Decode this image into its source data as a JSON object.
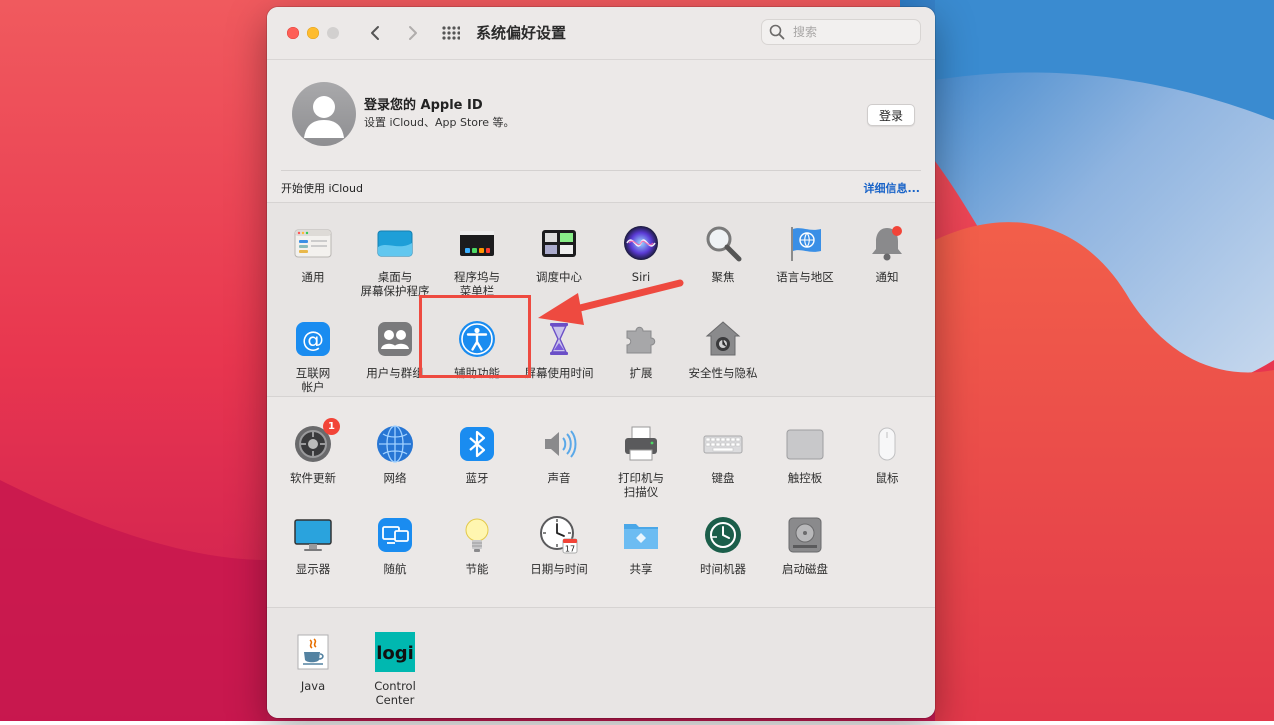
{
  "window": {
    "title": "系统偏好设置",
    "search_placeholder": "搜索"
  },
  "account": {
    "title": "登录您的 Apple ID",
    "subtitle": "设置 iCloud、App Store 等。",
    "signin_label": "登录"
  },
  "icloud": {
    "label": "开始使用 iCloud",
    "link": "详细信息..."
  },
  "panes_row1": [
    {
      "label": "通用",
      "icon": "general-icon"
    },
    {
      "label": "桌面与\n屏幕保护程序",
      "icon": "desktop-screensaver-icon"
    },
    {
      "label": "程序坞与\n菜单栏",
      "icon": "dock-menubar-icon"
    },
    {
      "label": "调度中心",
      "icon": "mission-control-icon"
    },
    {
      "label": "Siri",
      "icon": "siri-icon"
    },
    {
      "label": "聚焦",
      "icon": "spotlight-icon"
    },
    {
      "label": "语言与地区",
      "icon": "language-region-icon"
    },
    {
      "label": "通知",
      "icon": "notifications-icon"
    }
  ],
  "panes_row2": [
    {
      "label": "互联网\n帐户",
      "icon": "internet-accounts-icon"
    },
    {
      "label": "用户与群组",
      "icon": "users-groups-icon"
    },
    {
      "label": "辅助功能",
      "icon": "accessibility-icon"
    },
    {
      "label": "屏幕使用时间",
      "icon": "screen-time-icon"
    },
    {
      "label": "扩展",
      "icon": "extensions-icon"
    },
    {
      "label": "安全性与隐私",
      "icon": "security-privacy-icon"
    }
  ],
  "panes_row3": [
    {
      "label": "软件更新",
      "icon": "software-update-icon",
      "badge": "1"
    },
    {
      "label": "网络",
      "icon": "network-icon"
    },
    {
      "label": "蓝牙",
      "icon": "bluetooth-icon"
    },
    {
      "label": "声音",
      "icon": "sound-icon"
    },
    {
      "label": "打印机与\n扫描仪",
      "icon": "printers-scanners-icon"
    },
    {
      "label": "键盘",
      "icon": "keyboard-icon"
    },
    {
      "label": "触控板",
      "icon": "trackpad-icon"
    },
    {
      "label": "鼠标",
      "icon": "mouse-icon"
    }
  ],
  "panes_row4": [
    {
      "label": "显示器",
      "icon": "displays-icon"
    },
    {
      "label": "随航",
      "icon": "sidecar-icon"
    },
    {
      "label": "节能",
      "icon": "energy-saver-icon"
    },
    {
      "label": "日期与时间",
      "icon": "date-time-icon",
      "calendar_day": "17"
    },
    {
      "label": "共享",
      "icon": "sharing-icon"
    },
    {
      "label": "时间机器",
      "icon": "time-machine-icon"
    },
    {
      "label": "启动磁盘",
      "icon": "startup-disk-icon"
    }
  ],
  "panes_other": [
    {
      "label": "Java",
      "icon": "java-icon"
    },
    {
      "label": "Control Center",
      "icon": "logi-control-center-icon",
      "logo_text": "logi"
    }
  ],
  "annotation": {
    "highlight_color": "#ee4a40",
    "target": "辅助功能"
  },
  "colors": {
    "close": "#fe5f57",
    "minimize": "#febc2e",
    "link": "#1a64c8",
    "badge": "#f24438"
  }
}
